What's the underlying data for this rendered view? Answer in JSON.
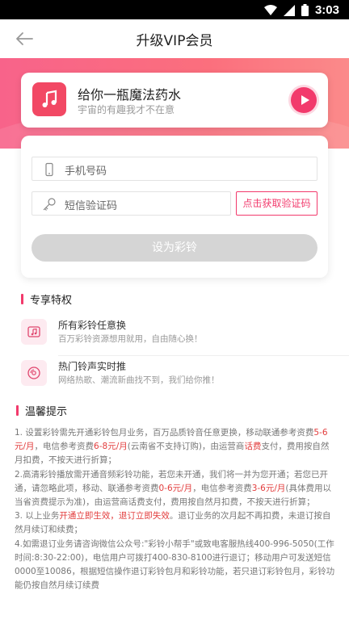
{
  "status_bar": {
    "time": "3:03",
    "icons": [
      "wifi-icon",
      "signal-icon",
      "battery-icon"
    ]
  },
  "nav": {
    "title": "升级VIP会员"
  },
  "song": {
    "title": "给你一瓶魔法药水",
    "subtitle": "宇宙的有趣我才不在意"
  },
  "form": {
    "phone_placeholder": "手机号码",
    "code_placeholder": "短信验证码",
    "get_code_label": "点击获取验证码",
    "submit_label": "设为彩铃"
  },
  "privileges": {
    "header": "专享特权",
    "items": [
      {
        "title": "所有彩铃任意换",
        "desc": "百万彩铃资源想用就用，自由随心换！"
      },
      {
        "title": "热门铃声实时推",
        "desc": "网络热歌、潮流新曲找不到，我们给你推！"
      }
    ]
  },
  "notice": {
    "header": "温馨提示",
    "p1": {
      "a": "1. 设置彩铃需先开通彩铃包月业务，百万品质铃音任意更换，移动联通参考资费",
      "h1": "5-6元/月",
      "b": "，电信参考资费",
      "h2": "6-8元/月",
      "c": "(云南省不支持订购)，由运营商",
      "h3": "话费",
      "d": "支付，费用按自然月扣费，不按天进行折算；"
    },
    "p2": {
      "a": "2.高清彩铃播放需开通音频彩铃功能，若您未开通，我们将一并为您开通；若您已开通，请忽略此项，移动、联通参考资费",
      "h1": "0-6元/月",
      "b": "，电信参考资费",
      "h2": "3-6元/月",
      "c": "(具体费用以当省资费提示为准)，由运营商话费支付，费用按自然月扣费，不按天进行折算；"
    },
    "p3": {
      "a": "3. 以上业务",
      "h1": "开通立即生效，退订立即失效",
      "b": "。退订业务的次月起不再扣费，未退订按自然月续订和续费；"
    },
    "p4": {
      "a": "4.如需退订业务请咨询微信公众号:\"彩铃小帮手\"或致电客服热线400-996-5050(工作时间:8:30-22:00)，电信用户可拨打400-830-8100进行退订；移动用户可发送短信0000至10086，根据短信操作退订彩铃包月和彩铃功能，若只退订彩铃包月，彩铃功能仍按自然月续订续费"
    }
  },
  "colors": {
    "accent": "#f23a6c",
    "hero_start": "#f8638a",
    "hero_end": "#fb8a8a",
    "highlight": "#e23c3c"
  }
}
